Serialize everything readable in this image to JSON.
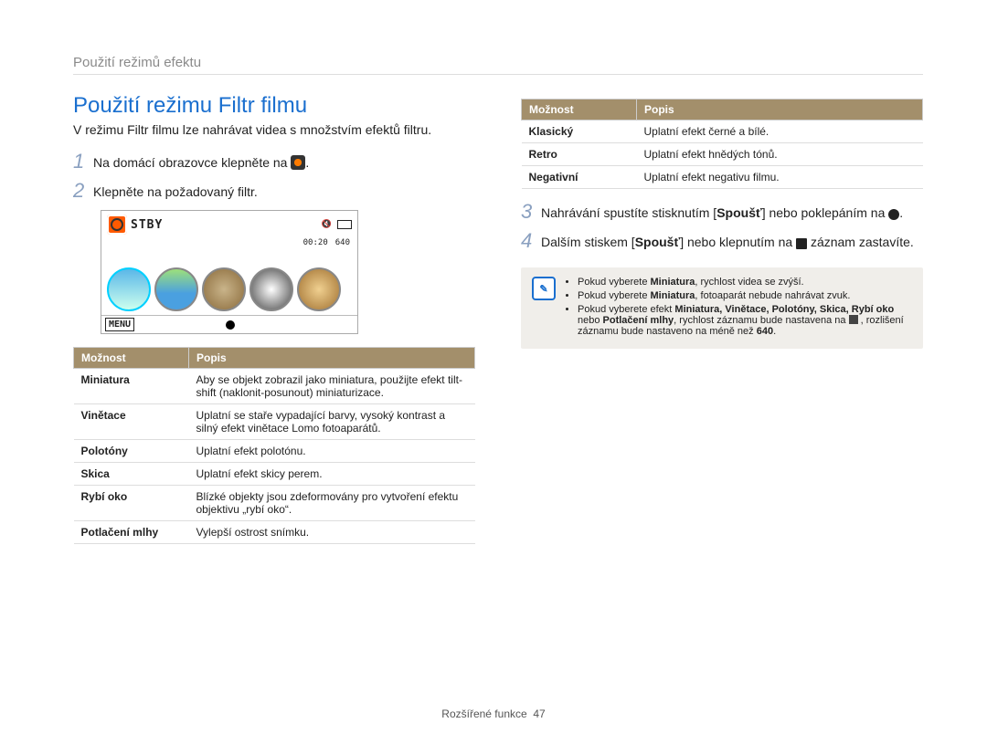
{
  "breadcrumb": "Použití režimů efektu",
  "title": "Použití režimu Filtr filmu",
  "intro": "V režimu Filtr filmu lze nahrávat videa s množstvím efektů filtru.",
  "steps_left": [
    {
      "num": "1",
      "text": "Na domácí obrazovce klepněte na ",
      "icon": "orange"
    },
    {
      "num": "2",
      "text": "Klepněte na požadovaný filtr."
    }
  ],
  "preview": {
    "stby": "STBY",
    "time": "00:20",
    "res": "640",
    "menu": "MENU"
  },
  "table_headers": {
    "opt": "Možnost",
    "desc": "Popis"
  },
  "left_table": [
    {
      "name": "Miniatura",
      "desc": "Aby se objekt zobrazil jako miniatura, použijte efekt tilt-shift (naklonit-posunout) miniaturizace."
    },
    {
      "name": "Vinětace",
      "desc": "Uplatní se staře vypadající barvy, vysoký kontrast a silný efekt vinětace Lomo fotoaparátů."
    },
    {
      "name": "Polotóny",
      "desc": "Uplatní efekt polotónu."
    },
    {
      "name": "Skica",
      "desc": "Uplatní efekt skicy perem."
    },
    {
      "name": "Rybí oko",
      "desc": "Blízké objekty jsou zdeformovány pro vytvoření efektu objektivu „rybí oko“."
    },
    {
      "name": "Potlačení mlhy",
      "desc": "Vylepší ostrost snímku."
    }
  ],
  "right_table": [
    {
      "name": "Klasický",
      "desc": "Uplatní efekt černé a bílé."
    },
    {
      "name": "Retro",
      "desc": "Uplatní efekt hnědých tónů."
    },
    {
      "name": "Negativní",
      "desc": "Uplatní efekt negativu filmu."
    }
  ],
  "steps_right": [
    {
      "num": "3",
      "pre": "Nahrávání spustíte stisknutím [",
      "bold": "Spoušť",
      "post": "] nebo poklepáním na ",
      "icon": "dot",
      "tail": "."
    },
    {
      "num": "4",
      "pre": "Dalším stiskem [",
      "bold": "Spoušť",
      "post": "] nebo klepnutím na ",
      "icon": "square",
      "tail": " záznam zastavíte."
    }
  ],
  "notes": [
    {
      "pre": "Pokud vyberete ",
      "bold": "Miniatura",
      "post": ", rychlost videa se zvýší."
    },
    {
      "pre": "Pokud vyberete ",
      "bold": "Miniatura",
      "post": ", fotoaparát nebude nahrávat zvuk."
    },
    {
      "pre": "Pokud vyberete efekt ",
      "bold": "Miniatura, Vinětace, Polotóny, Skica, Rybí oko",
      "post_pre": " nebo ",
      "bold2": "Potlačení mlhy",
      "post": ", rychlost záznamu bude nastavena na ",
      "post2": " , rozlišení záznamu bude nastaveno na méně než ",
      "bold3": "640",
      "tail": "."
    }
  ],
  "footer": {
    "label": "Rozšířené funkce",
    "page": "47"
  }
}
